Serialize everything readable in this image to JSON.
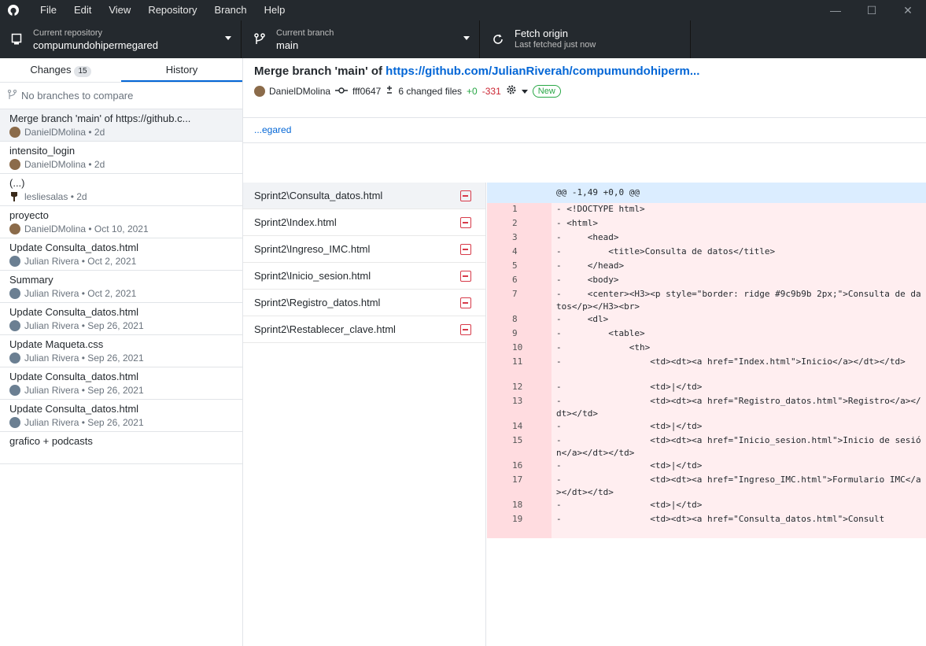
{
  "titlebar": {
    "menu": [
      "File",
      "Edit",
      "View",
      "Repository",
      "Branch",
      "Help"
    ],
    "minimize": "—",
    "maximize": "☐",
    "close": "✕"
  },
  "toolbar": {
    "repo_label": "Current repository",
    "repo_value": "compumundohipermegared",
    "branch_label": "Current branch",
    "branch_value": "main",
    "fetch_label": "Fetch origin",
    "fetch_value": "Last fetched just now"
  },
  "sidebar": {
    "tab_changes": "Changes",
    "tab_changes_count": "15",
    "tab_history": "History",
    "compare_placeholder": "No branches to compare",
    "commits": [
      {
        "title": "Merge branch 'main' of https://github.c...",
        "author": "DanielDMolina",
        "when": "2d"
      },
      {
        "title": "intensito_login",
        "author": "DanielDMolina",
        "when": "2d"
      },
      {
        "title": "(...)",
        "author": "lesliesalas",
        "when": "2d"
      },
      {
        "title": "proyecto",
        "author": "DanielDMolina",
        "when": "Oct 10, 2021"
      },
      {
        "title": "Update Consulta_datos.html",
        "author": "Julian Rivera",
        "when": "Oct 2, 2021"
      },
      {
        "title": "Summary",
        "author": "Julian Rivera",
        "when": "Oct 2, 2021"
      },
      {
        "title": "Update Consulta_datos.html",
        "author": "Julian Rivera",
        "when": "Sep 26, 2021"
      },
      {
        "title": "Update Maqueta.css",
        "author": "Julian Rivera",
        "when": "Sep 26, 2021"
      },
      {
        "title": "Update Consulta_datos.html",
        "author": "Julian Rivera",
        "when": "Sep 26, 2021"
      },
      {
        "title": "Update Consulta_datos.html",
        "author": "Julian Rivera",
        "when": "Sep 26, 2021"
      },
      {
        "title": "grafico + podcasts",
        "author": "",
        "when": ""
      }
    ]
  },
  "commit": {
    "title_prefix": "Merge branch 'main' of ",
    "title_link": "https://github.com/JulianRiverah/compumundohiperm...",
    "author": "DanielDMolina",
    "sha": "fff0647",
    "changed": "6 changed files",
    "additions": "+0",
    "deletions": "-331",
    "badge": "New",
    "description": "...egared"
  },
  "files": [
    "Sprint2\\Consulta_datos.html",
    "Sprint2\\Index.html",
    "Sprint2\\Ingreso_IMC.html",
    "Sprint2\\Inicio_sesion.html",
    "Sprint2\\Registro_datos.html",
    "Sprint2\\Restablecer_clave.html"
  ],
  "diff": {
    "hunk": "@@ -1,49 +0,0 @@",
    "lines": [
      {
        "n": "1",
        "text": "- <!DOCTYPE html>"
      },
      {
        "n": "2",
        "text": "- <html>"
      },
      {
        "n": "3",
        "text": "-     <head>"
      },
      {
        "n": "4",
        "text": "-         <title>Consulta de datos</title>"
      },
      {
        "n": "5",
        "text": "-     </head>"
      },
      {
        "n": "6",
        "text": "-     <body>"
      },
      {
        "n": "7",
        "text": "-     <center><H3><p style=\"border: ridge #9c9b9b 2px;\">Consulta de datos</p></H3><br>"
      },
      {
        "n": "8",
        "text": "-     <dl>"
      },
      {
        "n": "9",
        "text": "-         <table>"
      },
      {
        "n": "10",
        "text": "-             <th>"
      },
      {
        "n": "11",
        "text": "-                 <td><dt><a href=\"Index.html\">Inicio</a></dt></td>"
      },
      {
        "n": "12",
        "text": "-                 <td>|</td>"
      },
      {
        "n": "13",
        "text": "-                 <td><dt><a href=\"Registro_datos.html\">Registro</a></dt></td>"
      },
      {
        "n": "14",
        "text": "-                 <td>|</td>"
      },
      {
        "n": "15",
        "text": "-                 <td><dt><a href=\"Inicio_sesion.html\">Inicio de sesión</a></dt></td>"
      },
      {
        "n": "16",
        "text": "-                 <td>|</td>"
      },
      {
        "n": "17",
        "text": "-                 <td><dt><a href=\"Ingreso_IMC.html\">Formulario IMC</a></dt></td>"
      },
      {
        "n": "18",
        "text": "-                 <td>|</td>"
      },
      {
        "n": "19",
        "text": "-                 <td><dt><a href=\"Consulta_datos.html\">Consult"
      }
    ]
  },
  "colors": {
    "titlebar_bg": "#24292e",
    "accent": "#0366d6",
    "deletion_bg": "#ffeef0",
    "deletion_gutter": "#ffdce0",
    "hunk_bg": "#dbedff"
  },
  "icons": [
    "github-logo-icon",
    "repo-icon",
    "branch-icon",
    "sync-icon",
    "branch-compare-icon",
    "commit-icon",
    "diff-icon",
    "gear-icon",
    "file-deleted-icon"
  ]
}
